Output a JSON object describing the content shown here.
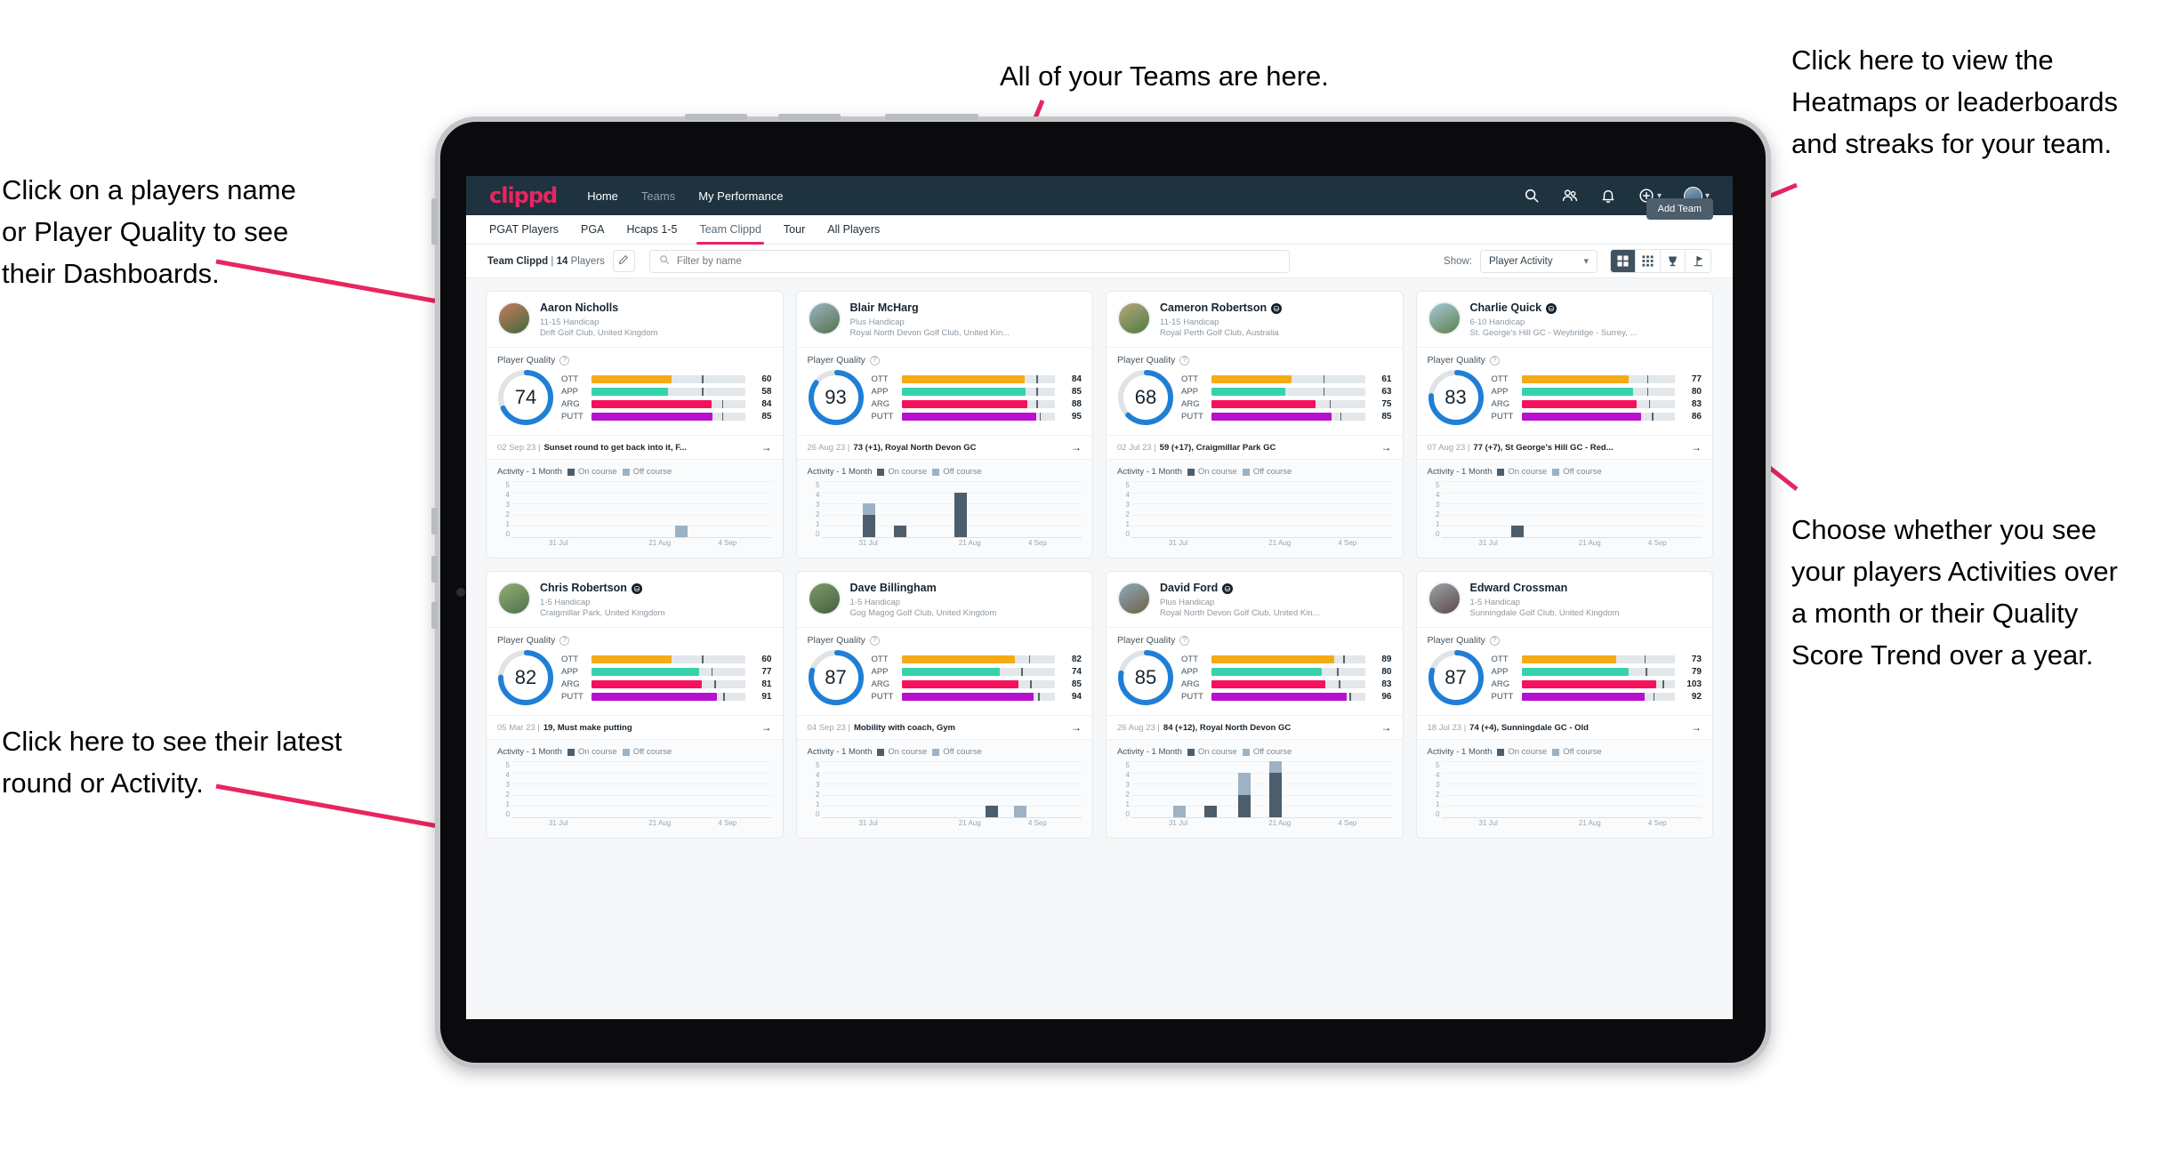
{
  "annotations": {
    "top_left": "Click on a players name\nor Player Quality to see\ntheir Dashboards.",
    "bottom_left": "Click here to see their latest\nround or Activity.",
    "top_center": "All of your Teams are here.",
    "top_right": "Click here to view the\nHeatmaps or leaderboards\nand streaks for your team.",
    "bottom_right": "Choose whether you see\nyour players Activities over\na month or their Quality\nScore Trend over a year.",
    "arrow_color": "#e8255f"
  },
  "app": {
    "brand": "clippd",
    "nav_links": [
      {
        "label": "Home",
        "active": true
      },
      {
        "label": "Teams",
        "active": false
      },
      {
        "label": "My Performance",
        "active": true
      }
    ],
    "nav_icons": [
      "search-icon",
      "people-icon",
      "bell-icon",
      "plus-circle-icon",
      "avatar"
    ],
    "tabs": [
      {
        "label": "PGAT Players",
        "active": false
      },
      {
        "label": "PGA",
        "active": false
      },
      {
        "label": "Hcaps 1-5",
        "active": false
      },
      {
        "label": "Team Clippd",
        "active": true
      },
      {
        "label": "Tour",
        "active": false
      },
      {
        "label": "All Players",
        "active": false
      }
    ],
    "add_team_label": "Add Team",
    "filter_bar": {
      "team_name": "Team Clippd",
      "separator": "|",
      "player_count": "14",
      "players_word": "Players",
      "edit_icon": "pencil-icon",
      "search_placeholder": "Filter by name",
      "search_value": "",
      "show_label": "Show:",
      "show_value": "Player Activity",
      "show_options": [
        "Player Activity",
        "Quality Score Trend"
      ],
      "view_toggles": [
        {
          "icon": "grid-large-icon",
          "active": true
        },
        {
          "icon": "grid-small-icon",
          "active": false
        },
        {
          "icon": "trophy-icon",
          "active": false
        },
        {
          "icon": "flag-icon",
          "active": false
        }
      ]
    }
  },
  "card_labels": {
    "player_quality": "Player Quality",
    "activity": "Activity - 1 Month",
    "legend_on": "On course",
    "legend_off": "Off course",
    "help_icon": "help-circle-icon",
    "arrow_icon": "arrow-right-icon"
  },
  "metric_colors": {
    "OTT": "#f5ab17",
    "APP": "#35d2ab",
    "ARG": "#f5115c",
    "PUTT": "#b810cf",
    "ring": "#1f7fd6",
    "ring_track": "#dfe3e6"
  },
  "chart_axis": {
    "y_ticks": [
      "5",
      "4",
      "3",
      "2",
      "1",
      "0"
    ],
    "y_max": 5,
    "x_ticks": [
      "31 Jul",
      "21 Aug",
      "4 Sep"
    ]
  },
  "players": [
    {
      "name": "Aaron Nicholls",
      "verified": false,
      "handicap": "11-15 Handicap",
      "club": "Drift Golf Club, United Kingdom",
      "quality": 74,
      "avatar_from": "#c97a5e",
      "avatar_to": "#3f6b3a",
      "metrics": [
        {
          "label": "OTT",
          "value": 60,
          "fill": 52,
          "tick": 72
        },
        {
          "label": "APP",
          "value": 58,
          "fill": 50,
          "tick": 72
        },
        {
          "label": "ARG",
          "value": 84,
          "fill": 78,
          "tick": 85
        },
        {
          "label": "PUTT",
          "value": 85,
          "fill": 79,
          "tick": 85
        }
      ],
      "round_date": "02 Sep 23",
      "round_text": "Sunset round to get back into it, F...",
      "activity": [
        {
          "x": 63,
          "on": 0,
          "off": 1
        }
      ]
    },
    {
      "name": "Blair McHarg",
      "verified": false,
      "handicap": "Plus Handicap",
      "club": "Royal North Devon Golf Club, United Kin...",
      "quality": 93,
      "avatar_from": "#9bb3c4",
      "avatar_to": "#55734a",
      "metrics": [
        {
          "label": "OTT",
          "value": 84,
          "fill": 80,
          "tick": 88
        },
        {
          "label": "APP",
          "value": 85,
          "fill": 81,
          "tick": 88
        },
        {
          "label": "ARG",
          "value": 88,
          "fill": 82,
          "tick": 88
        },
        {
          "label": "PUTT",
          "value": 95,
          "fill": 88,
          "tick": 90
        }
      ],
      "round_date": "26 Aug 23",
      "round_text": "73 (+1), Royal North Devon GC",
      "activity": [
        {
          "x": 16,
          "on": 2,
          "off": 1
        },
        {
          "x": 28,
          "on": 1,
          "off": 0
        },
        {
          "x": 51,
          "on": 4,
          "off": 0
        }
      ]
    },
    {
      "name": "Cameron Robertson",
      "verified": true,
      "handicap": "11-15 Handicap",
      "club": "Royal Perth Golf Club, Australia",
      "quality": 68,
      "avatar_from": "#b9a77e",
      "avatar_to": "#4e7a42",
      "metrics": [
        {
          "label": "OTT",
          "value": 61,
          "fill": 52,
          "tick": 73
        },
        {
          "label": "APP",
          "value": 63,
          "fill": 48,
          "tick": 73
        },
        {
          "label": "ARG",
          "value": 75,
          "fill": 68,
          "tick": 77
        },
        {
          "label": "PUTT",
          "value": 85,
          "fill": 78,
          "tick": 84
        }
      ],
      "round_date": "02 Jul 23",
      "round_text": "59 (+17), Craigmillar Park GC",
      "activity": []
    },
    {
      "name": "Charlie Quick",
      "verified": true,
      "handicap": "6-10 Handicap",
      "club": "St. George's Hill GC - Weybridge - Surrey, ...",
      "quality": 83,
      "avatar_from": "#a8c6dd",
      "avatar_to": "#5c8348",
      "metrics": [
        {
          "label": "OTT",
          "value": 77,
          "fill": 70,
          "tick": 82
        },
        {
          "label": "APP",
          "value": 80,
          "fill": 73,
          "tick": 82
        },
        {
          "label": "ARG",
          "value": 83,
          "fill": 75,
          "tick": 83
        },
        {
          "label": "PUTT",
          "value": 86,
          "fill": 78,
          "tick": 85
        }
      ],
      "round_date": "07 Aug 23",
      "round_text": "77 (+7), St George's Hill GC - Red...",
      "activity": [
        {
          "x": 27,
          "on": 1,
          "off": 0
        }
      ]
    },
    {
      "name": "Chris Robertson",
      "verified": true,
      "handicap": "1-5 Handicap",
      "club": "Craigmillar Park, United Kingdom",
      "quality": 82,
      "avatar_from": "#8fb074",
      "avatar_to": "#53704a",
      "metrics": [
        {
          "label": "OTT",
          "value": 60,
          "fill": 52,
          "tick": 72
        },
        {
          "label": "APP",
          "value": 77,
          "fill": 70,
          "tick": 78
        },
        {
          "label": "ARG",
          "value": 81,
          "fill": 72,
          "tick": 80
        },
        {
          "label": "PUTT",
          "value": 91,
          "fill": 82,
          "tick": 86
        }
      ],
      "round_date": "05 Mar 23",
      "round_text": "19, Must make putting",
      "activity": []
    },
    {
      "name": "Dave Billingham",
      "verified": false,
      "handicap": "1-5 Handicap",
      "club": "Gog Magog Golf Club, United Kingdom",
      "quality": 87,
      "avatar_from": "#7e9b6a",
      "avatar_to": "#44603e",
      "metrics": [
        {
          "label": "OTT",
          "value": 82,
          "fill": 74,
          "tick": 83
        },
        {
          "label": "APP",
          "value": 74,
          "fill": 64,
          "tick": 78
        },
        {
          "label": "ARG",
          "value": 85,
          "fill": 76,
          "tick": 84
        },
        {
          "label": "PUTT",
          "value": 94,
          "fill": 86,
          "tick": 89
        }
      ],
      "round_date": "04 Sep 23",
      "round_text": "Mobility with coach, Gym",
      "activity": [
        {
          "x": 63,
          "on": 1,
          "off": 0
        },
        {
          "x": 74,
          "on": 0,
          "off": 1
        }
      ]
    },
    {
      "name": "David Ford",
      "verified": true,
      "handicap": "Plus Handicap",
      "club": "Royal North Devon Golf Club, United Kin...",
      "quality": 85,
      "avatar_from": "#8da8bb",
      "avatar_to": "#6f6348",
      "metrics": [
        {
          "label": "OTT",
          "value": 89,
          "fill": 80,
          "tick": 86
        },
        {
          "label": "APP",
          "value": 80,
          "fill": 72,
          "tick": 82
        },
        {
          "label": "ARG",
          "value": 83,
          "fill": 74,
          "tick": 83
        },
        {
          "label": "PUTT",
          "value": 96,
          "fill": 88,
          "tick": 90
        }
      ],
      "round_date": "26 Aug 23",
      "round_text": "84 (+12), Royal North Devon GC",
      "activity": [
        {
          "x": 16,
          "on": 0,
          "off": 1
        },
        {
          "x": 28,
          "on": 1,
          "off": 0
        },
        {
          "x": 41,
          "on": 2,
          "off": 2
        },
        {
          "x": 53,
          "on": 4,
          "off": 1
        }
      ]
    },
    {
      "name": "Edward Crossman",
      "verified": false,
      "handicap": "1-5 Handicap",
      "club": "Sunningdale Golf Club, United Kingdom",
      "quality": 87,
      "avatar_from": "#9aa3ab",
      "avatar_to": "#5d4a46",
      "metrics": [
        {
          "label": "OTT",
          "value": 73,
          "fill": 62,
          "tick": 80
        },
        {
          "label": "APP",
          "value": 79,
          "fill": 70,
          "tick": 81
        },
        {
          "label": "ARG",
          "value": 103,
          "fill": 88,
          "tick": 92
        },
        {
          "label": "PUTT",
          "value": 92,
          "fill": 80,
          "tick": 86
        }
      ],
      "round_date": "18 Jul 23",
      "round_text": "74 (+4), Sunningdale GC - Old",
      "activity": []
    }
  ]
}
